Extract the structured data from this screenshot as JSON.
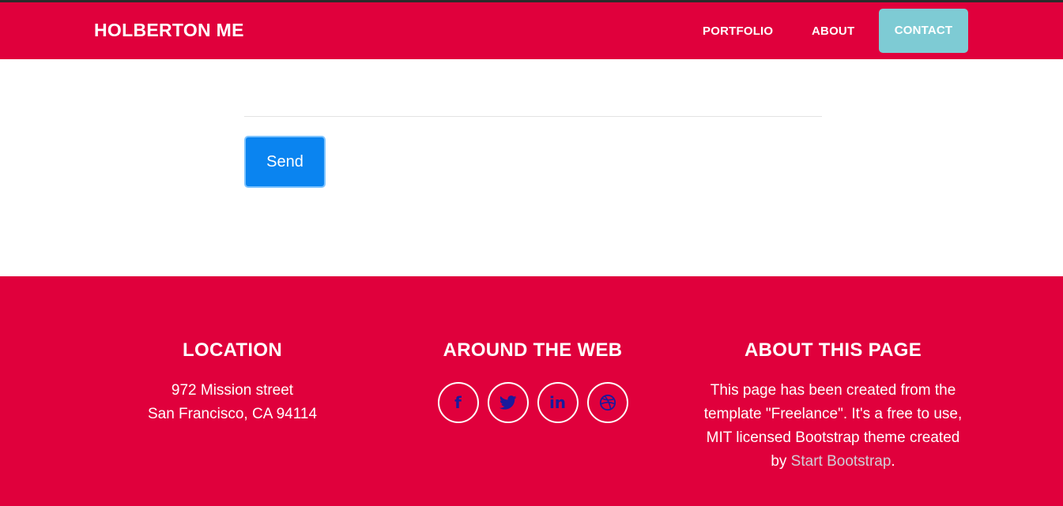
{
  "nav": {
    "brand": "HOLBERTON ME",
    "links": [
      {
        "label": "PORTFOLIO"
      },
      {
        "label": "ABOUT"
      },
      {
        "label": "CONTACT"
      }
    ]
  },
  "form": {
    "send_label": "Send"
  },
  "footer": {
    "location": {
      "title": "LOCATION",
      "line1": "972 Mission street",
      "line2": "San Francisco, CA 94114"
    },
    "web": {
      "title": "AROUND THE WEB",
      "icons": [
        {
          "name": "facebook-icon",
          "glyph": "f"
        },
        {
          "name": "twitter-icon",
          "glyph": ""
        },
        {
          "name": "linkedin-icon",
          "glyph": "in"
        },
        {
          "name": "dribbble-icon",
          "glyph": ""
        }
      ]
    },
    "about": {
      "title": "ABOUT THIS PAGE",
      "text": "This page has been created from the template \"Freelance\". It's a free to use, MIT licensed Bootstrap theme created by ",
      "link_label": "Start Bootstrap",
      "suffix": "."
    }
  },
  "colors": {
    "primary_red": "#e0003c",
    "contact_highlight": "#7ecbd4",
    "send_button": "#0a84f0",
    "icon_color": "#1a1a9c"
  }
}
